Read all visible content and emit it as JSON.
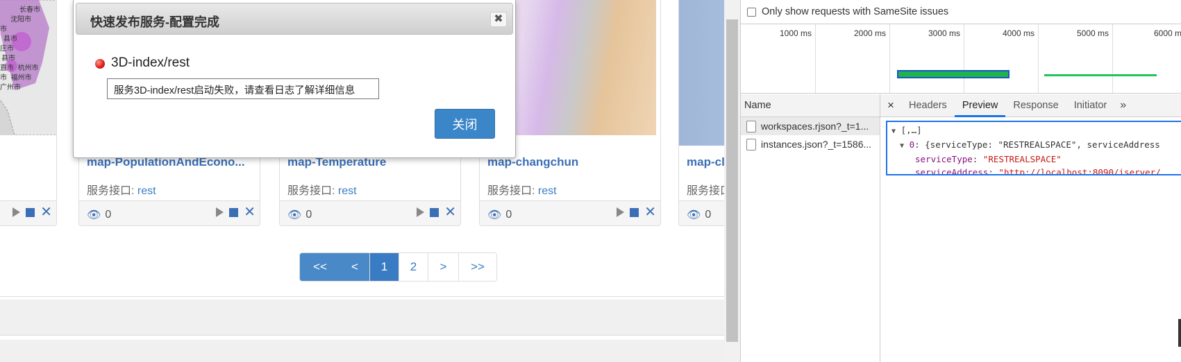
{
  "modal": {
    "title": "快速发布服务-配置完成",
    "close_glyph": "✖",
    "service_name": "3D-index/rest",
    "error_message": "服务3D-index/rest启动失败，请查看日志了解详细信息",
    "close_button": "关闭",
    "status_color": "#e02020"
  },
  "cards": [
    {
      "title": "map-PopulationAndEcono...",
      "iface_label": "服务接口:",
      "iface_link": "rest",
      "views": "0"
    },
    {
      "title": "map-Temperature",
      "iface_label": "服务接口:",
      "iface_link": "rest",
      "views": "0"
    },
    {
      "title": "map-changchun",
      "iface_label": "服务接口:",
      "iface_link": "rest",
      "views": "0"
    },
    {
      "title": "map-cl",
      "iface_label": "服务接口",
      "iface_link": "",
      "views": "0"
    }
  ],
  "left_card": {
    "views": ""
  },
  "map_labels": [
    "长春市",
    "沈阳市",
    "市",
    "县市",
    "庄市",
    "县市",
    "杭州市",
    "直市",
    "福州市",
    "市",
    "广州市"
  ],
  "pagination": [
    "<<",
    "<",
    "1",
    "2",
    ">",
    ">>"
  ],
  "devtools": {
    "filter_label": "Only show requests with SameSite issues",
    "timeline_ticks": [
      "1000 ms",
      "2000 ms",
      "3000 ms",
      "4000 ms",
      "5000 ms",
      "6000 m"
    ],
    "name_header": "Name",
    "requests": [
      "workspaces.rjson?_t=1...",
      "instances.json?_t=1586..."
    ],
    "tabs": [
      "Headers",
      "Preview",
      "Response",
      "Initiator"
    ],
    "tab_close": "×",
    "tab_more": "»",
    "preview": {
      "line1": "[,…]",
      "line2_index": "0",
      "line2_rest": ": {serviceType: \"RESTREALSPACE\", serviceAddress",
      "key1": "serviceType",
      "val1": "\"RESTREALSPACE\"",
      "key2": "serviceAddress",
      "val2": "\"http://localhost:8090/iserver/"
    }
  }
}
